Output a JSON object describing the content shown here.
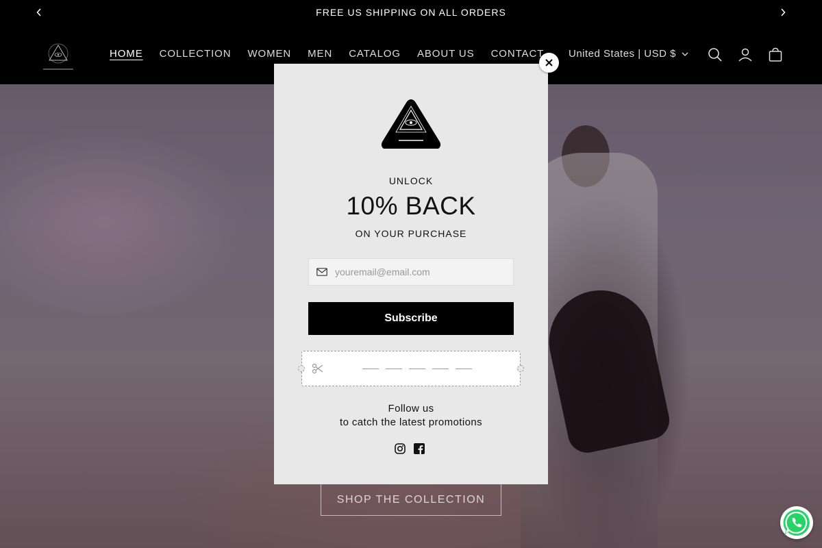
{
  "announcement": {
    "text": "FREE US SHIPPING ON ALL ORDERS"
  },
  "nav": {
    "items": [
      {
        "label": "HOME",
        "active": true
      },
      {
        "label": "COLLECTION"
      },
      {
        "label": "WOMEN"
      },
      {
        "label": "MEN"
      },
      {
        "label": "CATALOG"
      },
      {
        "label": "ABOUT US"
      },
      {
        "label": "CONTACT"
      }
    ],
    "currency": "United States | USD $"
  },
  "hero": {
    "cta_label": "SHOP THE COLLECTION"
  },
  "popup": {
    "headline_top": "UNLOCK",
    "headline_main": "10% BACK",
    "headline_bottom": "ON YOUR PURCHASE",
    "email_placeholder": "youremail@email.com",
    "email_value": "",
    "subscribe_label": "Subscribe",
    "follow_line1": "Follow us",
    "follow_line2": "to catch the latest promotions"
  },
  "colors": {
    "header_bg": "#000000",
    "popup_bg": "#e8e8e8",
    "button_bg": "#000000",
    "whatsapp": "#25D366"
  },
  "icons": [
    "chevron-left-icon",
    "chevron-right-icon",
    "search-icon",
    "account-icon",
    "cart-icon",
    "close-icon",
    "mail-icon",
    "scissors-icon",
    "instagram-icon",
    "facebook-icon",
    "whatsapp-icon"
  ]
}
